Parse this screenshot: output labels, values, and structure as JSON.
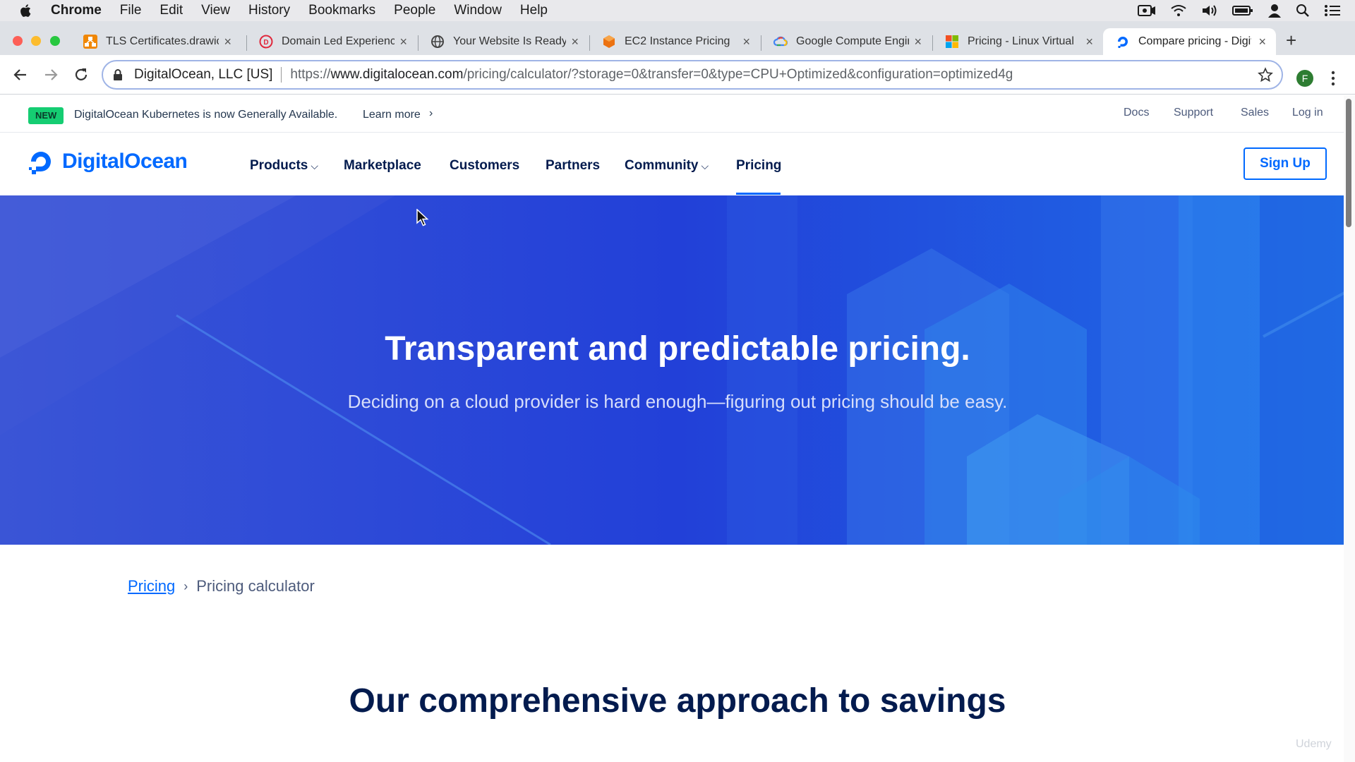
{
  "os_menubar": {
    "app": "Chrome",
    "items": [
      "File",
      "Edit",
      "View",
      "History",
      "Bookmarks",
      "People",
      "Window",
      "Help"
    ],
    "status_icons": [
      "screen-record-icon",
      "wifi-icon",
      "volume-icon",
      "battery-icon",
      "user-icon",
      "spotlight-icon",
      "notification-center-icon"
    ]
  },
  "tabs": [
    {
      "title": "TLS Certificates.drawio",
      "icon": "drawio-favicon",
      "close": "×"
    },
    {
      "title": "Domain Led Experience",
      "icon": "red-d-favicon",
      "close": "×"
    },
    {
      "title": "Your Website Is Ready",
      "icon": "globe-favicon",
      "close": "×"
    },
    {
      "title": "EC2 Instance Pricing",
      "icon": "aws-favicon",
      "close": "×"
    },
    {
      "title": "Google Compute Engine",
      "icon": "google-cloud-favicon",
      "close": "×"
    },
    {
      "title": "Pricing - Linux Virtual",
      "icon": "microsoft-favicon",
      "close": "×"
    },
    {
      "title": "Compare pricing - DigitalOcean",
      "icon": "digitalocean-favicon",
      "close": "×",
      "active": true
    }
  ],
  "new_tab": "+",
  "address_bar": {
    "origin": "DigitalOcean, LLC [US]",
    "url_prefix": "https://",
    "url_host": "www.digitalocean.com",
    "url_path": "/pricing/calculator/?storage=0&transfer=0&type=CPU+Optimized&configuration=optimized4g"
  },
  "profile_initial": "F",
  "announcement": {
    "badge": "NEW",
    "text": "DigitalOcean Kubernetes is now Generally Available.",
    "link": "Learn more",
    "chevron": "›"
  },
  "top_links": [
    "Docs",
    "Support",
    "Sales",
    "Log in"
  ],
  "nav": {
    "logo": "DigitalOcean",
    "links": [
      "Products",
      "Marketplace",
      "Customers",
      "Partners",
      "Community",
      "Pricing"
    ],
    "caret": "⌵",
    "active": "Pricing",
    "signup": "Sign Up"
  },
  "hero": {
    "title": "Transparent and predictable pricing.",
    "subtitle": "Deciding on a cloud provider is hard enough—figuring out pricing should be easy."
  },
  "breadcrumb": {
    "parent": "Pricing",
    "separator": "›",
    "current": "Pricing calculator"
  },
  "section_title": "Our comprehensive approach to savings",
  "watermark": "Udemy",
  "colors": {
    "brand_blue": "#0069ff",
    "hero_blue": "#2448d8",
    "navy_text": "#031b4e",
    "new_badge_green": "#15cd72"
  }
}
